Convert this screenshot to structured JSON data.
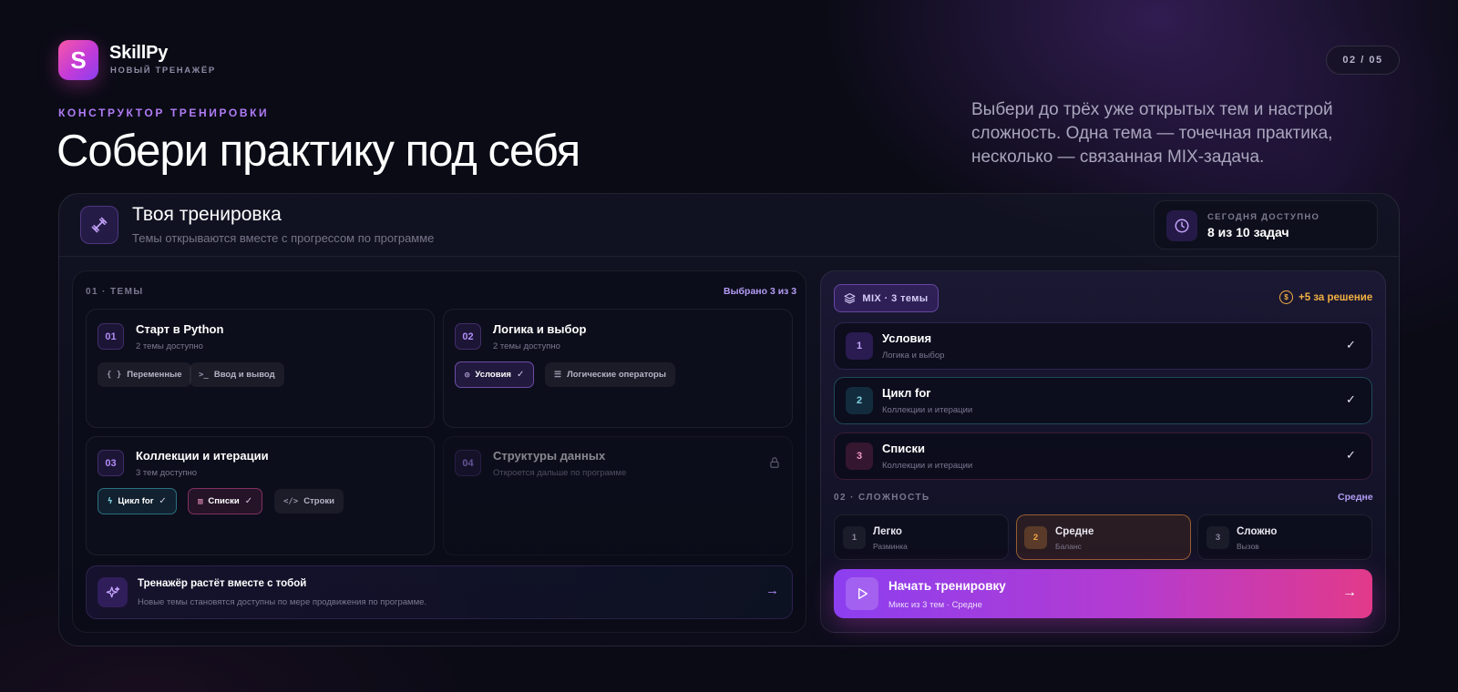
{
  "brand": {
    "logo_letter": "S",
    "name": "SkillPy",
    "subtitle": "НОВЫЙ ТРЕНАЖЁР"
  },
  "step": "02 / 05",
  "hero": {
    "eyebrow": "КОНСТРУКТОР ТРЕНИРОВКИ",
    "title": "Собери практику под себя",
    "description": "Выбери до трёх уже открытых тем и настрой сложность. Одна тема — точечная практика, несколько — связанная MIX-задача."
  },
  "workout": {
    "title": "Твоя тренировка",
    "subtitle": "Темы открываются вместе с прогрессом по программе",
    "today_label": "СЕГОДНЯ ДОСТУПНО",
    "today_value": "8 из 10 задач"
  },
  "topics_section": {
    "label": "01 · ТЕМЫ",
    "selected_text": "Выбрано 3 из 3",
    "topics": [
      {
        "num": "01",
        "title": "Старт в Python",
        "sub": "2 темы доступно",
        "chips": [
          {
            "icon": "{ }",
            "label": "Переменные"
          },
          {
            "icon": ">_",
            "label": "Ввод и вывод"
          }
        ]
      },
      {
        "num": "02",
        "title": "Логика и выбор",
        "sub": "2 темы доступно",
        "chips": [
          {
            "icon": "◎",
            "label": "Условия",
            "selected": true
          },
          {
            "icon": "☰",
            "label": "Логические операторы"
          }
        ]
      },
      {
        "num": "03",
        "title": "Коллекции и итерации",
        "sub": "3 тем доступно",
        "chips": [
          {
            "icon": "ϟ",
            "label": "Цикл for",
            "selected": true
          },
          {
            "icon": "▥",
            "label": "Списки",
            "selected": true
          },
          {
            "icon": "</>",
            "label": "Строки"
          }
        ]
      },
      {
        "num": "04",
        "title": "Структуры данных",
        "sub": "Откроется дальше по программе",
        "locked": true
      }
    ],
    "grow": {
      "title": "Тренажёр растёт вместе с тобой",
      "sub": "Новые темы становятся доступны по мере продвижения по программе."
    }
  },
  "mix": {
    "pill": "MIX · 3 темы",
    "bonus": "+5 за решение",
    "selected": [
      {
        "num": "1",
        "title": "Условия",
        "sub": "Логика и выбор"
      },
      {
        "num": "2",
        "title": "Цикл for",
        "sub": "Коллекции и итерации"
      },
      {
        "num": "3",
        "title": "Списки",
        "sub": "Коллекции и итерации"
      }
    ]
  },
  "difficulty": {
    "label": "02 · СЛОЖНОСТЬ",
    "current": "Средне",
    "levels": [
      {
        "num": "1",
        "title": "Легко",
        "sub": "Разминка"
      },
      {
        "num": "2",
        "title": "Средне",
        "sub": "Баланс",
        "active": true
      },
      {
        "num": "3",
        "title": "Сложно",
        "sub": "Вызов"
      }
    ]
  },
  "start": {
    "title": "Начать тренировку",
    "sub": "Микс из 3 тем · Средне"
  },
  "colors": {
    "accent_purple": "#8c3ff0",
    "accent_pink": "#e23a8a",
    "bonus_gold": "#f0b042",
    "active_orange": "#f3a54a"
  }
}
